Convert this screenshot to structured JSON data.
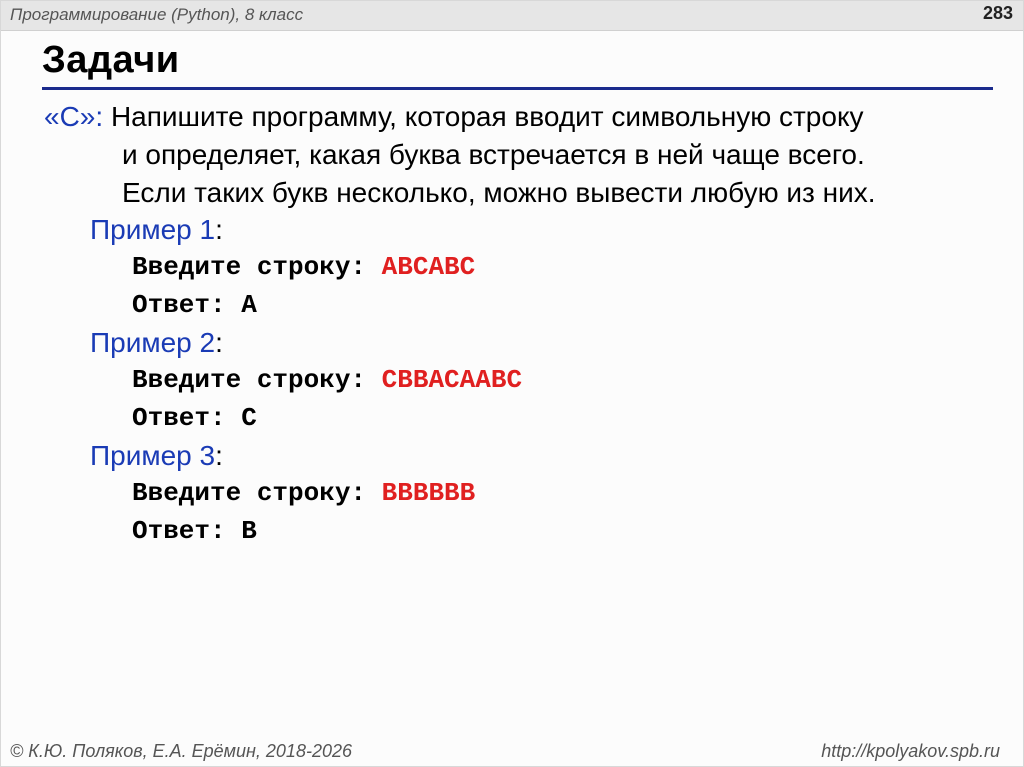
{
  "header": {
    "course_title": "Программирование (Python), 8 класс",
    "page_number": "283"
  },
  "title": "Задачи",
  "task": {
    "label": "«C»:",
    "lines": [
      "Напишите программу, которая вводит символьную строку",
      "и определяет, какая буква встречается в ней чаще всего.",
      "Если таких букв несколько, можно вывести любую из них."
    ]
  },
  "examples": [
    {
      "title": "Пример 1",
      "colon": ":",
      "prompt_label": "Введите строку: ",
      "input_value": "ABCABC",
      "answer_label": "Ответ: ",
      "answer_value": "A"
    },
    {
      "title": "Пример 2",
      "colon": ":",
      "prompt_label": "Введите строку: ",
      "input_value": "CBBACAABC",
      "answer_label": "Ответ: ",
      "answer_value": "C"
    },
    {
      "title": "Пример 3",
      "colon": ":",
      "prompt_label": "Введите строку: ",
      "input_value": "BBBBBB",
      "answer_label": "Ответ: ",
      "answer_value": "B"
    }
  ],
  "footer": {
    "copyright": "© К.Ю. Поляков, Е.А. Ерёмин, 2018-2026",
    "url": "http://kpolyakov.spb.ru"
  },
  "colors": {
    "accent_blue": "#1a3bb5",
    "rule_blue": "#1a2a8c",
    "input_red": "#e02020"
  }
}
